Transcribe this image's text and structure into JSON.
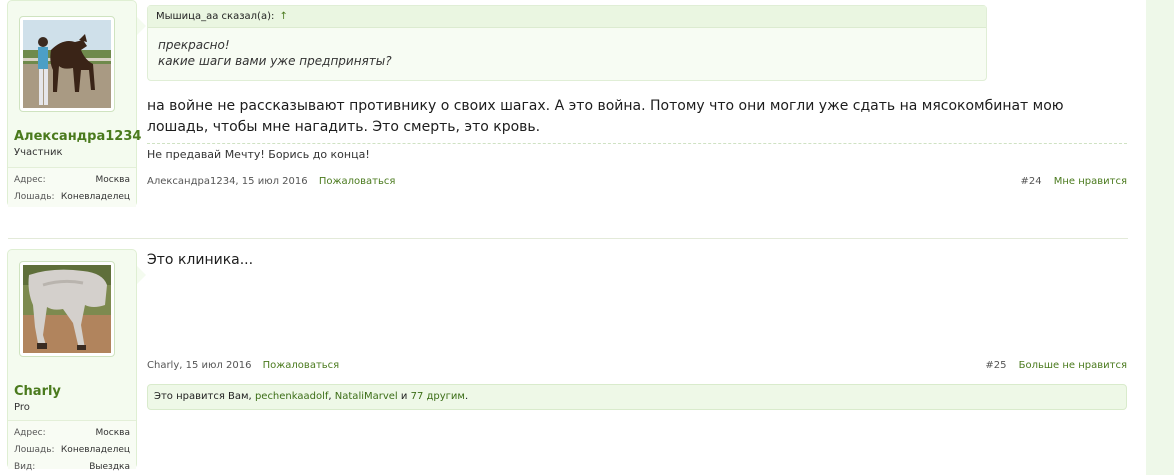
{
  "posts": [
    {
      "author": {
        "name": "Александра1234",
        "title": "Участник",
        "info": [
          {
            "key": "Адрес:",
            "value": "Москва"
          },
          {
            "key": "Лошадь:",
            "value": "Коневладелец"
          }
        ]
      },
      "quote": {
        "header": "Мышица_аа сказал(а):",
        "up_arrow": "↑",
        "lines": [
          "прекрасно!",
          "какие шаги вами уже предприняты?"
        ]
      },
      "message": "на войне не рассказывают противнику о своих шагах. А это война. Потому что они могли уже сдать на мясокомбинат мою лошадь, чтобы мне нагадить. Это смерть, это кровь.",
      "signature": "Не предавай Мечту! Борись до конца!",
      "meta": {
        "byline": "Александра1234, 15 июл 2016",
        "report": "Пожаловаться",
        "number": "#24",
        "like": "Мне нравится"
      }
    },
    {
      "author": {
        "name": "Charly",
        "title": "Pro",
        "info": [
          {
            "key": "Адрес:",
            "value": "Москва"
          },
          {
            "key": "Лошадь:",
            "value": "Коневладелец"
          },
          {
            "key": "Вид:",
            "value": "Выездка"
          }
        ]
      },
      "message": "Это клиника...",
      "meta": {
        "byline": "Charly, 15 июл 2016",
        "report": "Пожаловаться",
        "number": "#25",
        "like": "Больше не нравится"
      },
      "likes": {
        "prefix": "Это нравится Вам,",
        "user1": "pechenkaadolf",
        "sep": ",",
        "user2": "NataliMarvel",
        "and": "и",
        "others": "77 другим",
        "end": "."
      }
    }
  ],
  "colors": {
    "accent": "#4a7a1d",
    "card_bg": "#f4fbef",
    "band": "#eef8e9"
  }
}
